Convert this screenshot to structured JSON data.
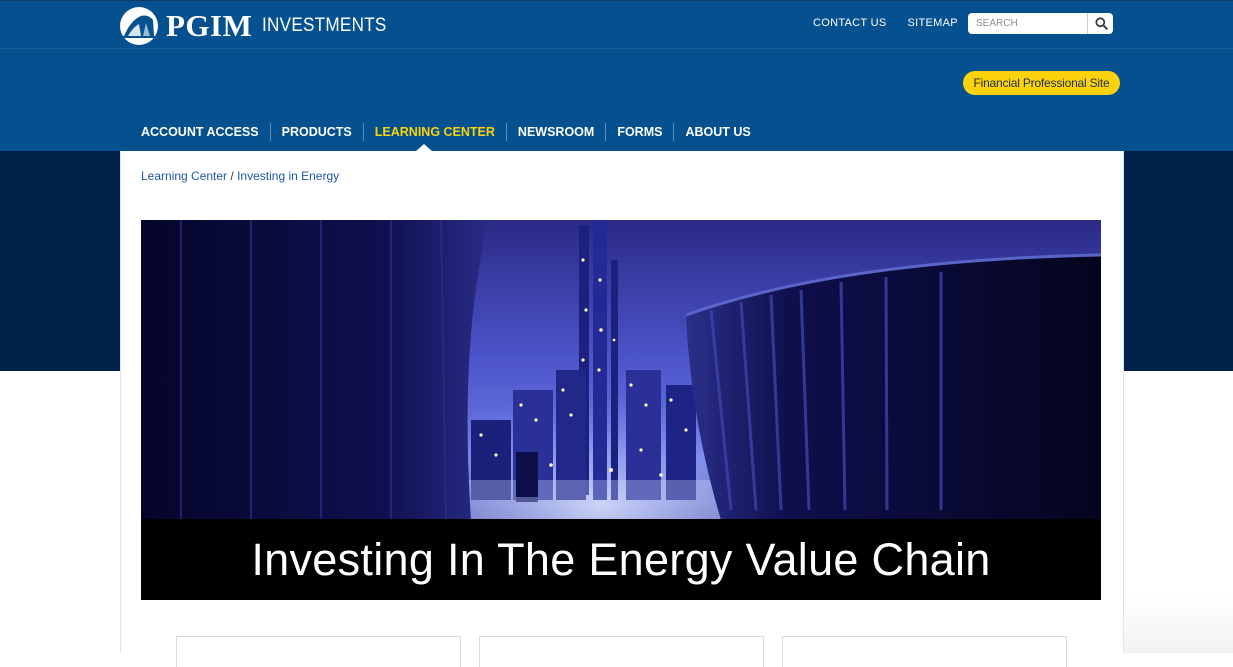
{
  "brand": {
    "name": "PGIM",
    "sub": "INVESTMENTS"
  },
  "top_links": [
    {
      "label": "CONTACT US"
    },
    {
      "label": "SITEMAP"
    }
  ],
  "search": {
    "placeholder": "SEARCH",
    "icon": "search-icon"
  },
  "financial_professional": {
    "label": "Financial Professional Site",
    "color": "#fbd20b"
  },
  "nav": {
    "items": [
      {
        "label": "ACCOUNT ACCESS",
        "active": false
      },
      {
        "label": "PRODUCTS",
        "active": false
      },
      {
        "label": "LEARNING CENTER",
        "active": true
      },
      {
        "label": "NEWSROOM",
        "active": false
      },
      {
        "label": "FORMS",
        "active": false
      },
      {
        "label": "ABOUT US",
        "active": false
      }
    ]
  },
  "breadcrumb": {
    "parent": "Learning Center",
    "separator": "/",
    "current": "Investing in Energy"
  },
  "hero": {
    "caption": "Investing In The Energy Value Chain"
  },
  "colors": {
    "header": "#05508f",
    "band": "#02224a",
    "accent": "#fbd20b",
    "link": "#1e56a7"
  }
}
